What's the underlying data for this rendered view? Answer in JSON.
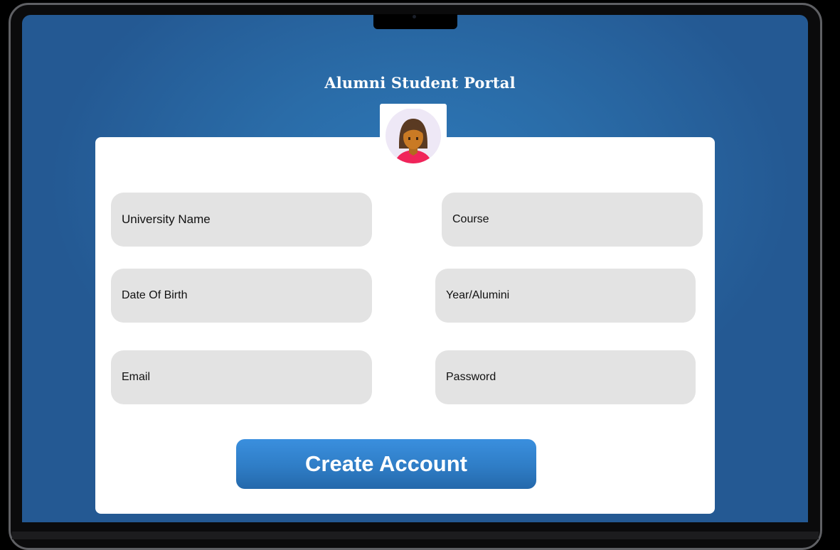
{
  "title": "Alumni Student Portal",
  "avatar": {
    "icon": "woman-avatar-icon"
  },
  "fields": {
    "university_name": "University Name",
    "course": "Course",
    "date_of_birth": "Date Of Birth",
    "year_alumini": "Year/Alumini",
    "email": "Email",
    "password": "Password"
  },
  "buttons": {
    "create_account": "Create Account"
  },
  "colors": {
    "background_blue": "#2a6ca8",
    "field_gray": "#e3e3e3",
    "button_blue": "#2f7dc6",
    "avatar_top": "#e91e63"
  }
}
